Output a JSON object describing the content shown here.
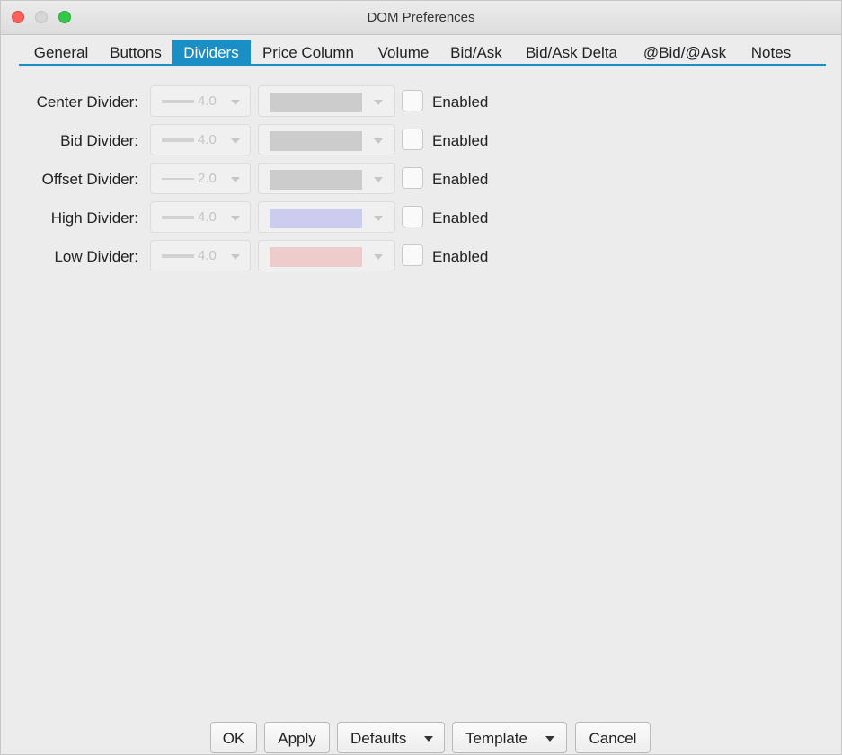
{
  "window": {
    "title": "DOM Preferences"
  },
  "tabs": [
    {
      "label": "General"
    },
    {
      "label": "Buttons"
    },
    {
      "label": "Dividers",
      "active": true
    },
    {
      "label": "Price Column"
    },
    {
      "label": "Volume"
    },
    {
      "label": "Bid/Ask"
    },
    {
      "label": "Bid/Ask Delta"
    },
    {
      "label": "@Bid/@Ask"
    },
    {
      "label": "Notes"
    }
  ],
  "dividers": [
    {
      "label": "Center Divider:",
      "width": "4.0",
      "color": "#cccccc",
      "enabled_label": "Enabled",
      "enabled": false
    },
    {
      "label": "Bid Divider:",
      "width": "4.0",
      "color": "#cccccc",
      "enabled_label": "Enabled",
      "enabled": false
    },
    {
      "label": "Offset Divider:",
      "width": "2.0",
      "color": "#cccccc",
      "enabled_label": "Enabled",
      "enabled": false
    },
    {
      "label": "High Divider:",
      "width": "4.0",
      "color": "#ccccee",
      "enabled_label": "Enabled",
      "enabled": false
    },
    {
      "label": "Low Divider:",
      "width": "4.0",
      "color": "#eecccc",
      "enabled_label": "Enabled",
      "enabled": false
    }
  ],
  "footer": {
    "ok": "OK",
    "apply": "Apply",
    "defaults": "Defaults",
    "template": "Template",
    "cancel": "Cancel"
  },
  "colors": {
    "accent": "#1a8fc6",
    "traffic_close": "#fc605c",
    "traffic_minimize": "#d6d6d6",
    "traffic_zoom": "#34c84a"
  },
  "icons": [
    "close-window-icon",
    "minimize-window-icon",
    "zoom-window-icon",
    "chevron-down-icon"
  ]
}
